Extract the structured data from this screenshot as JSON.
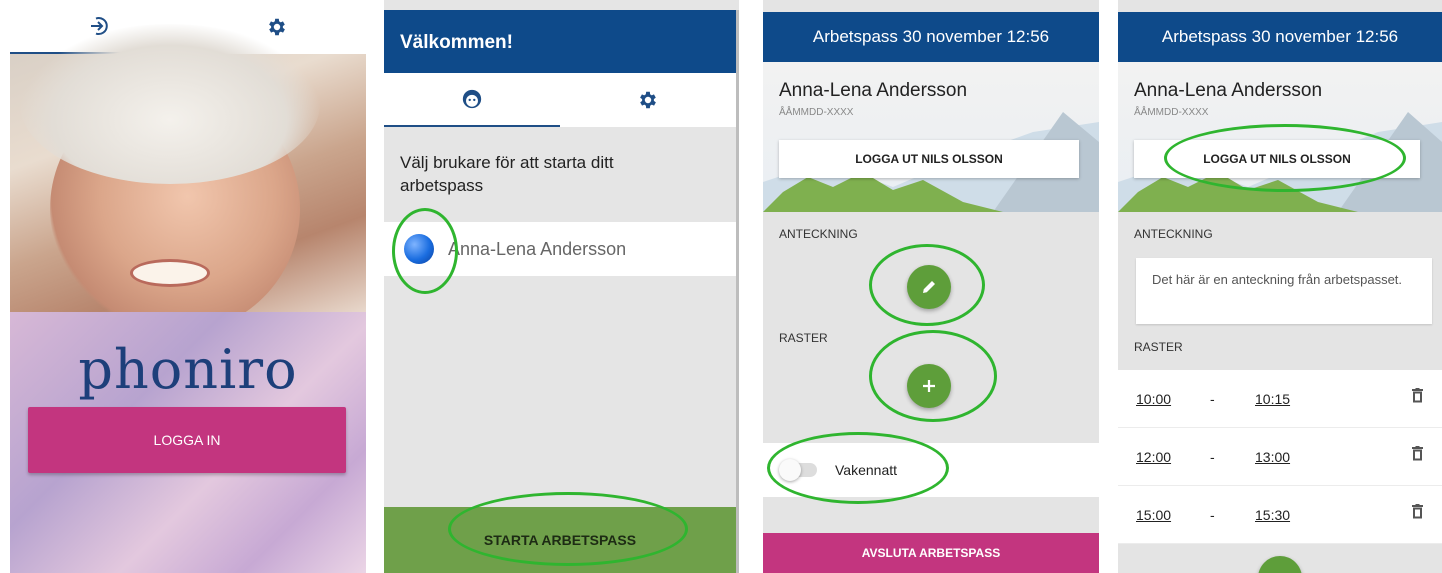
{
  "screen1": {
    "tabs": [
      {
        "icon": "login-icon"
      },
      {
        "icon": "gear-icon"
      }
    ],
    "brand": "phoniro",
    "login_button": "LOGGA IN",
    "colors": {
      "brand": "#1d3f7a",
      "login": "#c3357f"
    }
  },
  "screen2": {
    "title": "Välkommen!",
    "tabs": [
      {
        "icon": "smiley-icon"
      },
      {
        "icon": "gear-icon"
      }
    ],
    "prompt": "Välj brukare för att starta ditt arbetspass",
    "user_name": "Anna-Lena Andersson",
    "start_button": "STARTA ARBETSPASS",
    "colors": {
      "appbar": "#0e4a8a",
      "start": "#6fa04a"
    }
  },
  "screen3": {
    "title": "Arbetspass 30 november 12:56",
    "person_name": "Anna-Lena Andersson",
    "person_id": "ÅÅMMDD-XXXX",
    "logout_button": "LOGGA UT NILS OLSSON",
    "note_label": "ANTECKNING",
    "breaks_label": "RASTER",
    "toggle_label": "Vakennatt",
    "end_button": "AVSLUTA ARBETSPASS"
  },
  "screen4": {
    "title": "Arbetspass 30 november 12:56",
    "person_name": "Anna-Lena Andersson",
    "person_id": "ÅÅMMDD-XXXX",
    "logout_button": "LOGGA UT NILS OLSSON",
    "note_label": "ANTECKNING",
    "note_text": "Det här är en anteckning från arbetspasset.",
    "breaks_label": "RASTER",
    "breaks": [
      {
        "start": "10:00",
        "sep": "-",
        "end": "10:15"
      },
      {
        "start": "12:00",
        "sep": "-",
        "end": "13:00"
      },
      {
        "start": "15:00",
        "sep": "-",
        "end": "15:30"
      }
    ]
  },
  "highlight_color": "#2fb52f"
}
